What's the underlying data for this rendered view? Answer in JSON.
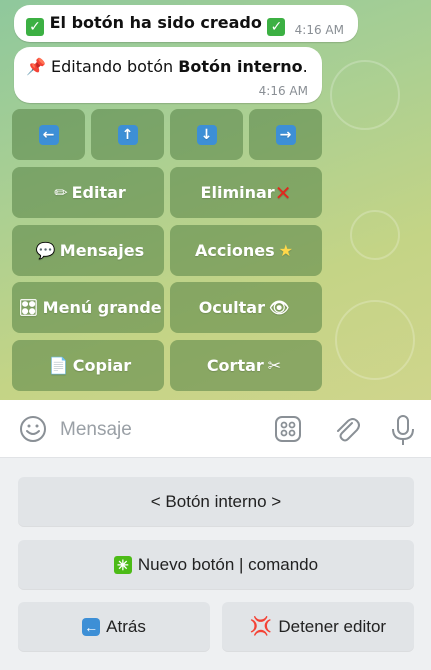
{
  "messages": [
    {
      "text": "El botón ha sido creado",
      "time": "4:16 AM",
      "icons": [
        "check-mark-button-icon",
        "check-mark-button-icon"
      ]
    },
    {
      "text_prefix": "Editando botón ",
      "text_bold": "Botón interno",
      "text_suffix": ".",
      "time": "4:16 AM",
      "icon": "pushpin-icon"
    }
  ],
  "inline_keyboard": {
    "arrows": [
      "left-arrow-icon",
      "up-arrow-icon",
      "down-arrow-icon",
      "right-arrow-icon"
    ],
    "buttons": [
      {
        "label": "Editar",
        "icon": "pencil-icon"
      },
      {
        "label": "Eliminar",
        "icon": "cross-mark-icon"
      },
      {
        "label": "Mensajes",
        "icon": "speech-balloon-icon"
      },
      {
        "label": "Acciones",
        "icon": "glowing-star-icon"
      },
      {
        "label": "Menú grande",
        "icon": "control-knobs-icon"
      },
      {
        "label": "Ocultar",
        "icon": "eye-icon"
      },
      {
        "label": "Copiar",
        "icon": "page-icon"
      },
      {
        "label": "Cortar",
        "icon": "scissors-icon"
      }
    ]
  },
  "composer": {
    "placeholder": "Mensaje"
  },
  "reply_keyboard": [
    {
      "label": "< Botón interno >"
    },
    {
      "label": "Nuevo botón | comando",
      "icon": "eight-spoked-asterisk-icon"
    },
    {
      "label": "Atrás",
      "icon": "back-arrow-icon"
    },
    {
      "label": "Detener editor",
      "icon": "anger-symbol-icon"
    }
  ],
  "colors": {
    "inline_button": "#5f8a4e",
    "keyboard_button": "#e1e4e7",
    "check_green": "#3cb043",
    "arrow_blue": "#3d8fd6"
  }
}
